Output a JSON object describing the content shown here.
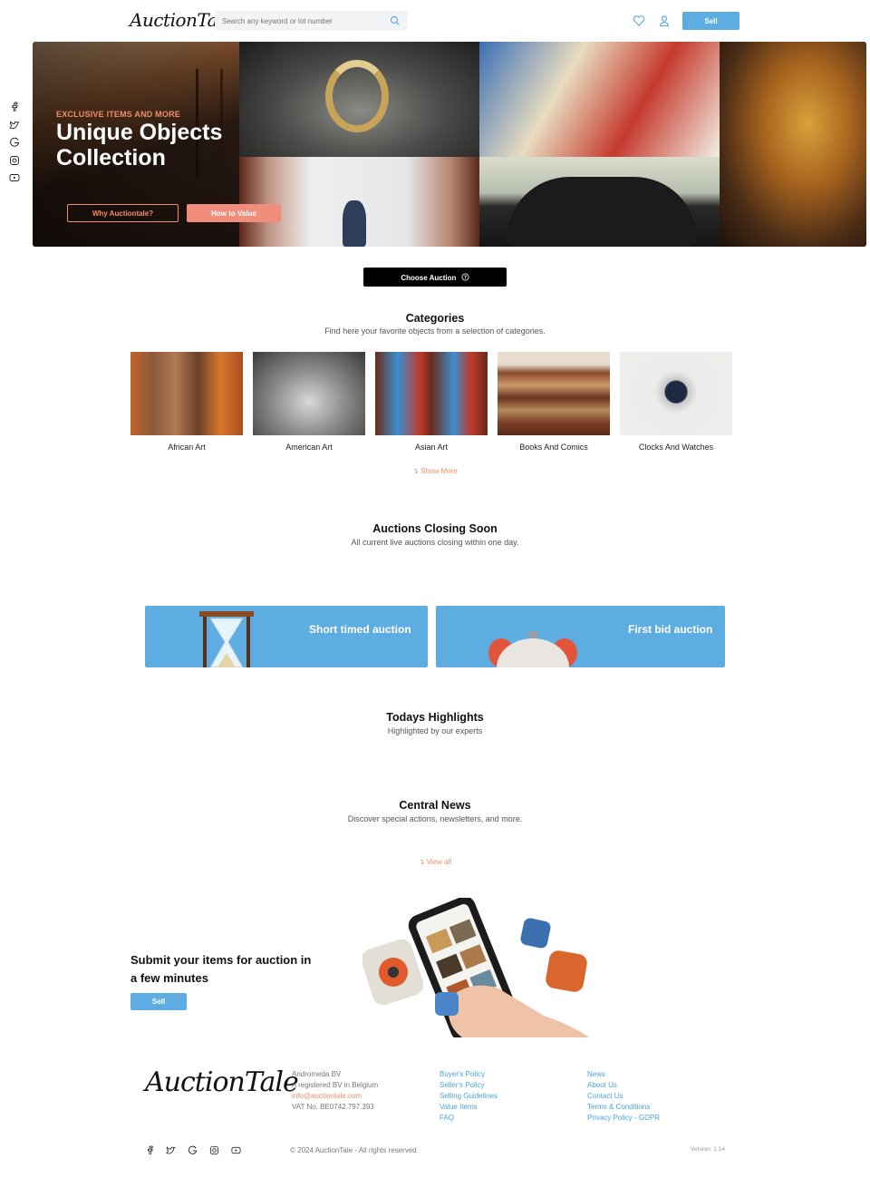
{
  "header": {
    "logo": "AuctionTale",
    "search_placeholder": "Search any keyword or lot number",
    "sell_label": "Sell"
  },
  "hero": {
    "kicker": "EXCLUSIVE ITEMS AND MORE",
    "title": "Unique Objects Collection",
    "btn_why": "Why Auctiontale?",
    "btn_value": "How to Value"
  },
  "choose_auction": "Choose Auction",
  "categories": {
    "title": "Categories",
    "subtitle": "Find here your favorite objects from a selection of categories.",
    "items": [
      {
        "label": "African Art"
      },
      {
        "label": "American Art"
      },
      {
        "label": "Asian Art"
      },
      {
        "label": "Books And Comics"
      },
      {
        "label": "Clocks And Watches"
      }
    ],
    "show_more": "Show More"
  },
  "closing": {
    "title": "Auctions Closing Soon",
    "subtitle": "All current live auctions closing within one day.",
    "cards": [
      {
        "label": "Short timed auction"
      },
      {
        "label": "First bid auction"
      }
    ]
  },
  "highlights": {
    "title": "Todays Highlights",
    "subtitle": "Highlighted by our experts"
  },
  "news": {
    "title": "Central News",
    "subtitle": "Discover special actions, newsletters, and more.",
    "view_all": "View all"
  },
  "promo": {
    "title": "Submit your items for auction in a few minutes",
    "button": "Sell"
  },
  "footer": {
    "logo": "AuctionTale",
    "company": [
      "Andromeda BV",
      "A registered BV in Belgium",
      "info@auctiontale.com",
      "VAT No. BE0742.797.393"
    ],
    "links1": [
      "Buyer's Policy",
      "Seller's Policy",
      "Selling Guidelines",
      "Value Items",
      "FAQ"
    ],
    "links2": [
      "News",
      "About Us",
      "Contact Us",
      "Terms & Conditions",
      "Privacy Policy - GDPR"
    ],
    "copyright": "© 2024 AuctionTale - All rights reserved",
    "version": "Version: 1.14"
  },
  "colors": {
    "accent_blue": "#5dade2",
    "accent_coral": "#f08d6c",
    "dark": "#000000"
  },
  "social_icons": [
    "facebook-icon",
    "twitter-icon",
    "google-icon",
    "instagram-icon",
    "youtube-icon"
  ]
}
